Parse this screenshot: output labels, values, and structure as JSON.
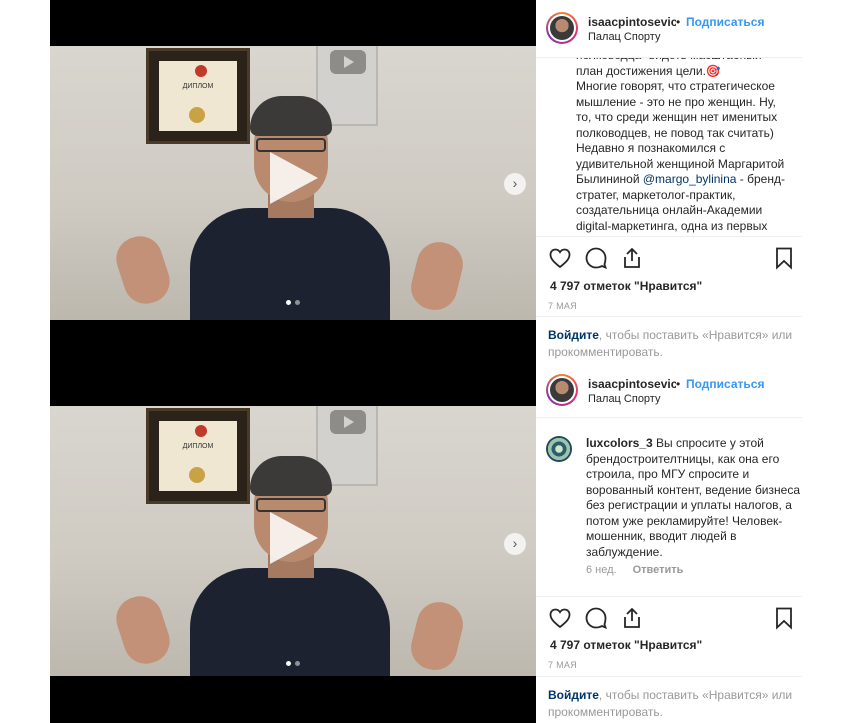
{
  "posts": [
    {
      "header": {
        "username": "isaacpintosevic",
        "bullet": "•",
        "follow_label": "Подписаться",
        "location": "Палац Спорту"
      },
      "caption": {
        "text_before": "полководца\" видеть масштабный\nплан достижения цели.🎯\nМногие говорят, что стратегическое\nмышление - это не про женщин. Ну,\nто, что среди женщин нет именитых\nполководцев, не повод так считать)\nНедавно я познакомился с\nудивительной женщиной Маргаритой\nБылининой ",
        "mention": "@margo_bylinina",
        "text_after": " - бренд-\nстратег, маркетолог-практик,\nсоздательница онлайн-Академии\ndigital-маркетинга, одна из первых\nзаговорила в инстаграме о важности"
      },
      "actions": {
        "like_icon": "heart-icon",
        "comment_icon": "comment-icon",
        "share_icon": "share-icon",
        "save_icon": "bookmark-icon"
      },
      "likes": "4 797 отметок \"Нравится\"",
      "date": "7 МАЯ",
      "login": {
        "link": "Войдите",
        "text": ", чтобы поставить «Нравится» или прокомментировать."
      },
      "video": {
        "play_icon": "play-icon",
        "next_icon": "chevron-right-icon",
        "slides": 2,
        "active_slide": 1
      }
    },
    {
      "header": {
        "username": "isaacpintosevic",
        "bullet": "•",
        "follow_label": "Подписаться",
        "location": "Палац Спорту"
      },
      "comment": {
        "username": "luxcolors_3",
        "text": " Вы спросите у этой брендостроителтницы, как она его строила, про МГУ спросите и ворованный контент, ведение бизнеса без регистрации и уплаты налогов, а потом уже рекламируйте! Человек- мошенник, вводит людей в заблуждение.",
        "age": "6 нед.",
        "reply_label": "Ответить"
      },
      "actions": {
        "like_icon": "heart-icon",
        "comment_icon": "comment-icon",
        "share_icon": "share-icon",
        "save_icon": "bookmark-icon"
      },
      "likes": "4 797 отметок \"Нравится\"",
      "date": "7 МАЯ",
      "login": {
        "link": "Войдите",
        "text": ", чтобы поставить «Нравится» или прокомментировать."
      },
      "video": {
        "play_icon": "play-icon",
        "next_icon": "chevron-right-icon",
        "slides": 2,
        "active_slide": 1
      }
    }
  ],
  "video_scene": {
    "diploma_label": "ДИПЛОМ"
  },
  "colors": {
    "link_blue": "#3897f0",
    "mention_blue": "#003569",
    "muted": "#999999",
    "text": "#262626"
  }
}
